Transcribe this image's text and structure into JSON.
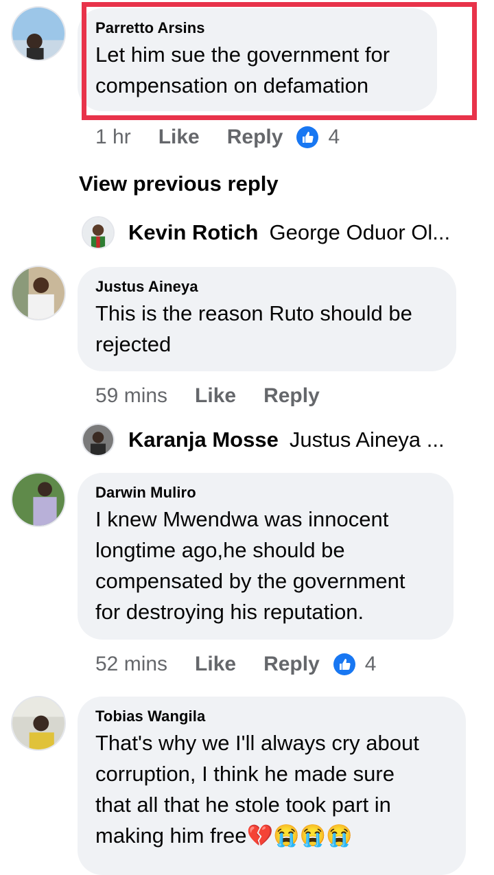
{
  "comments": [
    {
      "author": "Parretto Arsins",
      "text_lines": [
        "Let him sue the government for",
        "compensation on defamation"
      ],
      "time": "1 hr",
      "like": "Like",
      "reply": "Reply",
      "reaction_count": "4"
    },
    {
      "author": "Justus Aineya",
      "text_lines": [
        "This is the reason Ruto should be",
        "rejected"
      ],
      "time": "59 mins",
      "like": "Like",
      "reply": "Reply"
    },
    {
      "author": "Darwin Muliro",
      "text_lines": [
        "I knew Mwendwa was innocent",
        "longtime ago,he should be",
        "compensated by the government",
        "for destroying his reputation."
      ],
      "time": "52 mins",
      "like": "Like",
      "reply": "Reply",
      "reaction_count": "4"
    },
    {
      "author": "Tobias Wangila",
      "text_lines": [
        "That's why we I'll always cry about",
        "corruption, I think he made sure",
        "that all that he stole took part in",
        "making him free💔😭😭😭"
      ]
    }
  ],
  "view_previous_reply": "View previous reply",
  "replies": [
    {
      "name": "Kevin Rotich",
      "snippet": "George Oduor Ol..."
    },
    {
      "name": "Karanja Mosse",
      "snippet": "Justus Aineya ..."
    }
  ],
  "colors": {
    "highlight": "#e8334a",
    "like_blue": "#1877f2",
    "bubble": "#f0f2f5",
    "meta": "#65676b"
  },
  "icons": {
    "reaction": "thumbs-up-icon"
  }
}
